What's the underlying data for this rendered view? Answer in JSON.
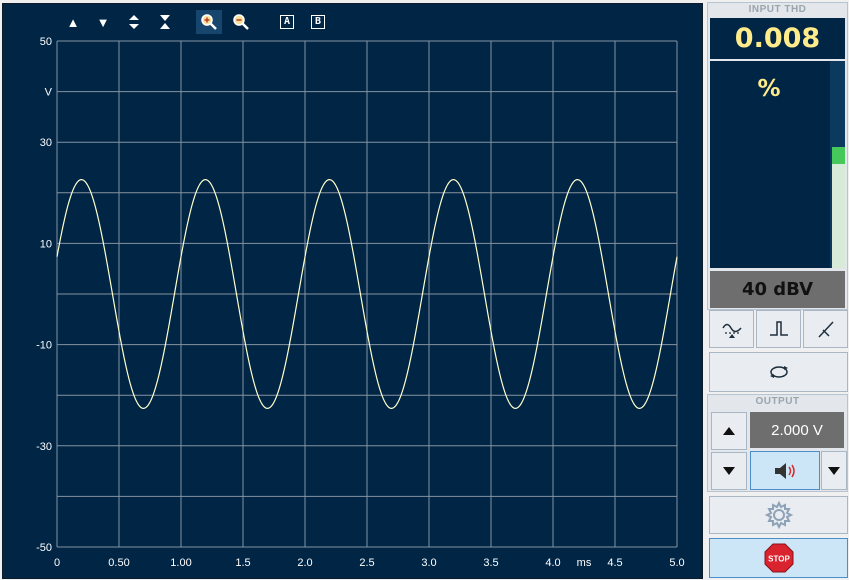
{
  "toolbar": {
    "buttons": [
      {
        "name": "move-up-icon",
        "glyph": "▲"
      },
      {
        "name": "move-down-icon",
        "glyph": "▼"
      },
      {
        "name": "expand-vertical-icon",
        "glyph": "⬍"
      },
      {
        "name": "compress-vertical-icon",
        "glyph": "⧗"
      },
      {
        "name": "zoom-in-icon",
        "glyph": "🔍"
      },
      {
        "name": "zoom-out-icon",
        "glyph": "🔍"
      }
    ],
    "cursor_a": "A",
    "cursor_b": "B"
  },
  "chart_data": {
    "type": "line",
    "title": "",
    "ylabel": "V",
    "xlabel": "ms",
    "ylim": [
      -50,
      50
    ],
    "xlim": [
      0,
      5.0
    ],
    "y_ticks": [
      50,
      30,
      10,
      -10,
      -30,
      -50
    ],
    "x_ticks": [
      "0",
      "0.50",
      "1.00",
      "1.5",
      "2.0",
      "2.5",
      "3.0",
      "3.5",
      "4.0",
      "4.5",
      "5.0"
    ],
    "grid": true,
    "color": "#ffffcc",
    "series": [
      {
        "frequency_khz": 1.0,
        "amplitude_v": 22.6,
        "offset_v": 0,
        "phase_deg": 19
      }
    ]
  },
  "thd_panel": {
    "header": "INPUT THD",
    "value": "0.008",
    "unit": "%",
    "range": "40 dBV",
    "meter_level_fraction": 0.5
  },
  "output_panel": {
    "header": "OUTPUT",
    "voltage": "2.000 V"
  },
  "colors": {
    "background": "#002545",
    "grid": "#8593a2",
    "trace": "#ffffcc",
    "readout": "#ffeb8a",
    "stop": "#d9232e"
  }
}
